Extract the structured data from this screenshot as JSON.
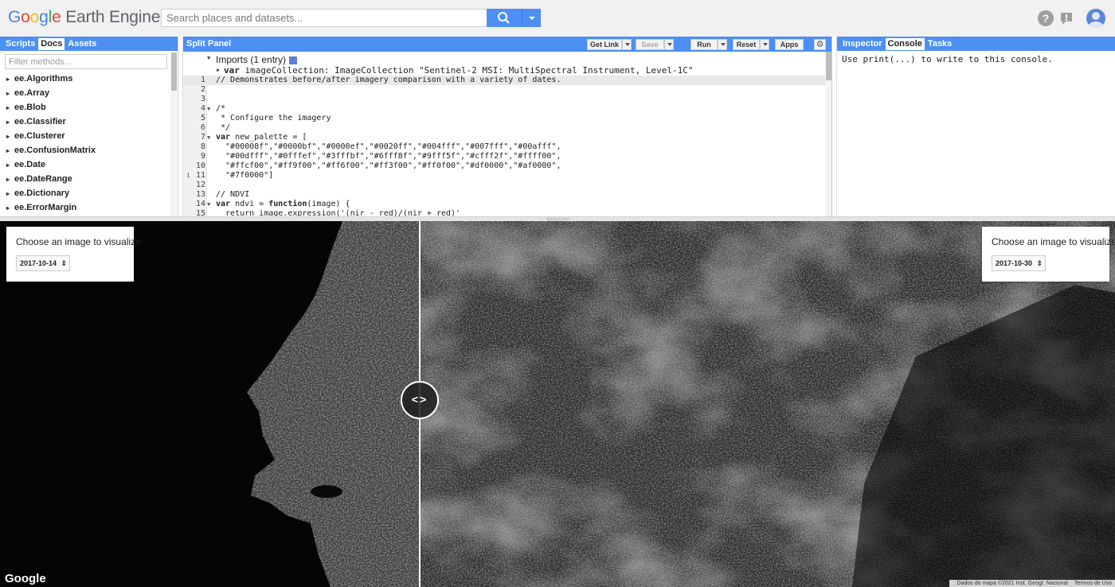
{
  "header": {
    "logo": {
      "google": "Google",
      "product": "Earth Engine"
    },
    "search_placeholder": "Search places and datasets...",
    "help_symbol": "?"
  },
  "left_panel": {
    "tabs": [
      {
        "label": "Scripts",
        "active": false
      },
      {
        "label": "Docs",
        "active": true
      },
      {
        "label": "Assets",
        "active": false
      }
    ],
    "filter_placeholder": "Filter methods...",
    "docs": [
      "ee.Algorithms",
      "ee.Array",
      "ee.Blob",
      "ee.Classifier",
      "ee.Clusterer",
      "ee.ConfusionMatrix",
      "ee.Date",
      "ee.DateRange",
      "ee.Dictionary",
      "ee.ErrorMargin"
    ]
  },
  "editor": {
    "title": "Split Panel",
    "toolbar": {
      "get_link": "Get Link",
      "save": "Save",
      "run": "Run",
      "reset": "Reset",
      "apps": "Apps",
      "settings_icon": "gear-icon"
    },
    "imports_header": "Imports (1 entry)",
    "imports_line": {
      "kw": "var",
      "name": "imageCollection",
      "type": ": ImageCollection",
      "value": "\"Sentinel-2 MSI: MultiSpectral Instrument, Level-1C\""
    },
    "lines": [
      {
        "num": "1",
        "text": "// Demonstrates before/after imagery comparison with a variety of dates.",
        "cls": "cm"
      },
      {
        "num": "2",
        "text": ""
      },
      {
        "num": "3",
        "text": ""
      },
      {
        "num": "4",
        "text": "/*",
        "cls": "cm",
        "fold": true
      },
      {
        "num": "5",
        "text": " * Configure the imagery",
        "cls": "cm"
      },
      {
        "num": "6",
        "text": " */",
        "cls": "cm"
      },
      {
        "num": "7",
        "kw": "var",
        "text": " new_palette = [",
        "fold": true
      },
      {
        "num": "8",
        "text": "  \"#00008f\",\"#0000bf\",\"#0000ef\",\"#0020ff\",\"#004fff\",\"#007fff\",\"#00afff\",",
        "cls": "str"
      },
      {
        "num": "9",
        "text": "  \"#00dfff\",\"#0fffef\",\"#3fffbf\",\"#6fff8f\",\"#9fff5f\",\"#cfff2f\",\"#ffff00\",",
        "cls": "str"
      },
      {
        "num": "10",
        "text": "  \"#ffcf00\",\"#ff9f00\",\"#ff6f00\",\"#ff3f00\",\"#ff0f00\",\"#df0000\",\"#af0000\",",
        "cls": "str"
      },
      {
        "num": "11",
        "text": "  \"#7f0000\"]",
        "cls": "str",
        "info": true
      },
      {
        "num": "12",
        "text": ""
      },
      {
        "num": "13",
        "text": "// NDVI",
        "cls": "cm"
      },
      {
        "num": "14",
        "kw": "var",
        "text": " ndvi = ",
        "kw2": "function",
        "text2": "(image) {",
        "fold": true
      },
      {
        "num": "15",
        "text": "  return image.expression('(nir - red)/(nir + red)'",
        "kw_lead": "return"
      }
    ]
  },
  "right_panel": {
    "tabs": [
      {
        "label": "Inspector",
        "active": false
      },
      {
        "label": "Console",
        "active": true
      },
      {
        "label": "Tasks",
        "active": false
      }
    ],
    "console_text": "Use print(...) to write to this console."
  },
  "map": {
    "left_card": {
      "title": "Choose an image to visualize",
      "date": "2017-10-14"
    },
    "right_card": {
      "title": "Choose an image to visualize",
      "date": "2017-10-30"
    },
    "slider_symbol": "<>",
    "logo": "Google",
    "attribution": "Dados do mapa ©2021 Inst. Geogr. Nacional",
    "terms": "Termos de Uso"
  },
  "colors": {
    "header_bg": "#f1f1f1",
    "panel_bar": "#4d8ff3",
    "map_bg": "#050505"
  }
}
